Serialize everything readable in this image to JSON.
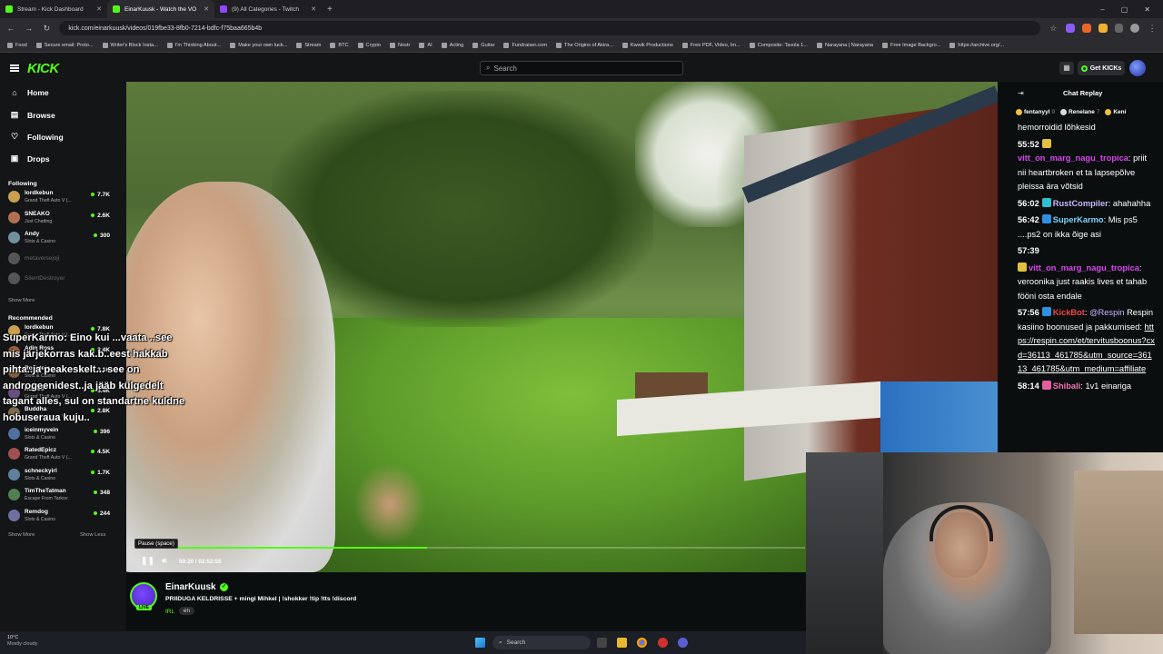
{
  "browser": {
    "tabs": [
      {
        "title": "Stream - Kick Dashboard",
        "icon": "kick-icon",
        "color": "#53fc18"
      },
      {
        "title": "EinarKuusk - Watch the VO",
        "icon": "kick-icon",
        "color": "#53fc18",
        "active": true
      },
      {
        "title": "(9) All Categories - Twitch",
        "icon": "twitch-icon",
        "color": "#9146ff"
      }
    ],
    "url": "kick.com/einarkuusk/videos/019fbe33-8fb0-7214-bdfc-f75baa665b4b",
    "bookmarks": [
      "Food",
      "Secure email: Proto...",
      "Writer's Block Insta...",
      "I'm Thinking About...",
      "Make your own luck...",
      "Stream",
      "BTC",
      "Crypto",
      "Nostr",
      "AI",
      "Acting",
      "Guitar",
      "Fundraiser.com",
      "The Origins of Akira...",
      "Kwwik Productions",
      "Free PDF, Video, Im...",
      "Composite: Tavola 1...",
      "Narayana | Narayana",
      "Free Image Backgro...",
      "https://archive.org/..."
    ]
  },
  "header": {
    "logo": "KICK",
    "search_placeholder": "Search",
    "get_kicks": "Get KICKs"
  },
  "sidebar": {
    "nav": [
      "Home",
      "Browse",
      "Following",
      "Drops"
    ],
    "following_title": "Following",
    "following": [
      {
        "name": "lordkebun",
        "category": "Grand Theft Auto V (...",
        "viewers": "7.7K",
        "color": "#c8a050"
      },
      {
        "name": "SNEAKO",
        "category": "Just Chatting",
        "viewers": "2.6K",
        "color": "#b07050"
      },
      {
        "name": "Andy",
        "category": "Slots & Casino",
        "viewers": "300",
        "color": "#7090a0"
      },
      {
        "name": "metaversejoji",
        "category": "",
        "viewers": "",
        "color": "#555",
        "offline": true
      },
      {
        "name": "SilentDestroyer",
        "category": "",
        "viewers": "",
        "color": "#555",
        "offline": true
      }
    ],
    "show_more": "Show More",
    "recommended_title": "Recommended",
    "recommended": [
      {
        "name": "lordkebun",
        "category": "Grand Theft Auto V (...",
        "viewers": "7.8K",
        "color": "#c8a050"
      },
      {
        "name": "Adin Ross",
        "category": "Just Chatting",
        "viewers": "8.4K",
        "color": "#a06040"
      },
      {
        "name": "Roshtein",
        "category": "Slots & Casino",
        "viewers": "3.1K",
        "color": "#806040"
      },
      {
        "name": "Ramee",
        "category": "Grand Theft Auto V (...",
        "viewers": "3.4K",
        "color": "#6a5080"
      },
      {
        "name": "Buddha",
        "category": "Grand Theft Auto V (...",
        "viewers": "2.8K",
        "color": "#806a50"
      },
      {
        "name": "iceinmyvein",
        "category": "Slots & Casino",
        "viewers": "396",
        "color": "#5070a0"
      },
      {
        "name": "RatedEpicz",
        "category": "Grand Theft Auto V (...",
        "viewers": "4.5K",
        "color": "#a05050"
      },
      {
        "name": "schneckyirl",
        "category": "Slots & Casino",
        "viewers": "1.7K",
        "color": "#6080a0"
      },
      {
        "name": "TimTheTatman",
        "category": "Escape From Tarkov",
        "viewers": "348",
        "color": "#508050"
      },
      {
        "name": "Remdog",
        "category": "Slots & Casino",
        "viewers": "244",
        "color": "#7070a0"
      }
    ],
    "show_more_2": "Show More",
    "show_less": "Show Less"
  },
  "player": {
    "tts_message": "SuperKarmo: Eino kui ...vaata ..see\nmis järjekorras kak.b..eest hakkab\npihta..ja peakeskelt... see on\nandrogeenidest..ja jääb külgedelt\ntagant alles, sul on standartne kuldne\nhobuseraua kuju..",
    "tooltip": "Pause (space)",
    "time": "59:20 / 02:52:55",
    "progress": 0.435
  },
  "stream": {
    "channel": "EinarKuusk",
    "title": "PRIIDUGA KELDRISSE + mingi Mihkel | !shokker !tip !tts !discord",
    "category": "IRL",
    "language": "en",
    "live_badge": "LIVE"
  },
  "chat": {
    "title": "Chat Replay",
    "gifters": [
      {
        "name": "fentanyyl",
        "count": "9",
        "color": "#f0c040"
      },
      {
        "name": "Renelane",
        "count": "7",
        "color": "#ddd"
      },
      {
        "name": "Keni",
        "count": "",
        "color": "#f0c040"
      }
    ],
    "messages": [
      {
        "time": "",
        "user": "",
        "user_color": "#fff",
        "text": "hemorroidid lõhkesid",
        "link": ""
      },
      {
        "time": "55:52",
        "user": "vitt_on_marg_nagu_tropica",
        "user_color": "#d946ef",
        "text": "priit nii heartbroken et ta lapsepõlve pleissa ära võtsid",
        "link": "",
        "badge": "#e0c040"
      },
      {
        "time": "56:02",
        "user": "RustCompiler",
        "user_color": "#c4b5fd",
        "text": "ahahahha",
        "link": "",
        "badge": "#30c0d0"
      },
      {
        "time": "56:42",
        "user": "SuperKarmo",
        "user_color": "#7dd3fc",
        "text": "Mis ps5 ....ps2 on ikka õige asi",
        "link": "",
        "badge": "#3090e0"
      },
      {
        "time": "57:39",
        "user": "",
        "user_color": "#fff",
        "text": "",
        "link": ""
      },
      {
        "time": "",
        "user": "vitt_on_marg_nagu_tropica",
        "user_color": "#d946ef",
        "text": "veroonika just raakis lives et tahab fööni osta endale",
        "link": "",
        "badge": "#e0c040"
      },
      {
        "time": "57:56",
        "user": "KickBot",
        "user_color": "#ef4444",
        "text": "Respin kasiino boonused ja pakkumised: ",
        "link": "https://respin.com/et/tervitusboonus?cxd=36113_461785&utm_source=36113_461785&utm_medium=affiliate",
        "badge": "#3090e0",
        "mention": "@Respin"
      },
      {
        "time": "58:14",
        "user": "Shibali",
        "user_color": "#f472b6",
        "text": "1v1 einariga",
        "link": "",
        "badge": "#e060a0"
      }
    ]
  },
  "taskbar": {
    "temp": "10°C",
    "condition": "Mostly cloudy",
    "search": "Search"
  }
}
